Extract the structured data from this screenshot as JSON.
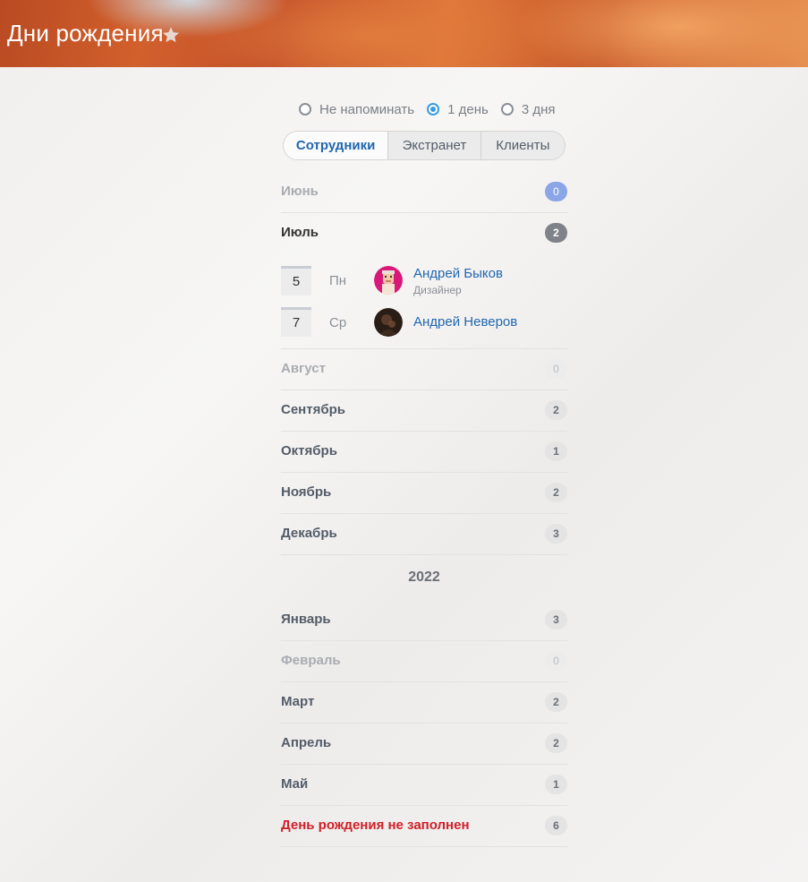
{
  "header": {
    "title": "Дни рождения",
    "star_icon": "star-icon"
  },
  "reminder": {
    "options": [
      {
        "label": "Не напоминать",
        "checked": false
      },
      {
        "label": "1 день",
        "checked": true
      },
      {
        "label": "3 дня",
        "checked": false
      }
    ]
  },
  "tabs": [
    {
      "label": "Сотрудники",
      "active": true
    },
    {
      "label": "Экстранет",
      "active": false
    },
    {
      "label": "Клиенты",
      "active": false
    }
  ],
  "months_current": [
    {
      "name": "Июнь",
      "count": "0"
    },
    {
      "name": "Июль",
      "count": "2"
    },
    {
      "name": "Август",
      "count": "0"
    },
    {
      "name": "Сентябрь",
      "count": "2"
    },
    {
      "name": "Октябрь",
      "count": "1"
    },
    {
      "name": "Ноябрь",
      "count": "2"
    },
    {
      "name": "Декабрь",
      "count": "3"
    }
  ],
  "july_birthdays": [
    {
      "day": "5",
      "weekday": "Пн",
      "name": "Андрей Быков",
      "role": "Дизайнер"
    },
    {
      "day": "7",
      "weekday": "Ср",
      "name": "Андрей Неверов",
      "role": ""
    }
  ],
  "year_label": "2022",
  "months_next": [
    {
      "name": "Январь",
      "count": "3"
    },
    {
      "name": "Февраль",
      "count": "0"
    },
    {
      "name": "Март",
      "count": "2"
    },
    {
      "name": "Апрель",
      "count": "2"
    },
    {
      "name": "Май",
      "count": "1"
    }
  ],
  "not_filled": {
    "label": "День рождения не заполнен",
    "count": "6"
  },
  "colors": {
    "link": "#2067b0",
    "accent_radio": "#3a9be0",
    "warning_red": "#d0202a",
    "june_badge": "#8aa6e6"
  }
}
